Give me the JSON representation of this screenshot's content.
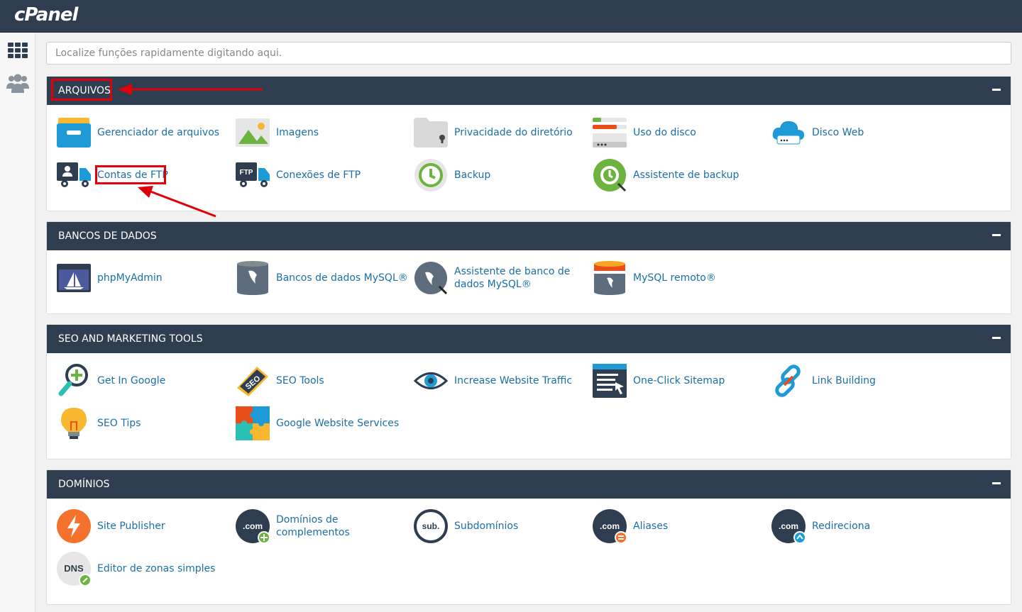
{
  "header": {
    "logo": "cPanel"
  },
  "sidebar": {
    "items": [
      {
        "icon": "grid-icon"
      },
      {
        "icon": "users-icon"
      }
    ]
  },
  "search": {
    "placeholder": "Localize funções rapidamente digitando aqui."
  },
  "sections": [
    {
      "title": "ARQUIVOS",
      "items": [
        {
          "label": "Gerenciador de arquivos",
          "icon": "file-manager-icon"
        },
        {
          "label": "Imagens",
          "icon": "images-icon"
        },
        {
          "label": "Privacidade do diretório",
          "icon": "directory-privacy-icon"
        },
        {
          "label": "Uso do disco",
          "icon": "disk-usage-icon"
        },
        {
          "label": "Disco Web",
          "icon": "web-disk-icon"
        },
        {
          "label": "Contas de FTP",
          "icon": "ftp-accounts-icon"
        },
        {
          "label": "Conexões de FTP",
          "icon": "ftp-connections-icon"
        },
        {
          "label": "Backup",
          "icon": "backup-icon"
        },
        {
          "label": "Assistente de backup",
          "icon": "backup-wizard-icon"
        }
      ]
    },
    {
      "title": "BANCOS DE DADOS",
      "items": [
        {
          "label": "phpMyAdmin",
          "icon": "phpmyadmin-icon"
        },
        {
          "label": "Bancos de dados MySQL®",
          "icon": "mysql-databases-icon"
        },
        {
          "label": "Assistente de banco de dados MySQL®",
          "icon": "mysql-wizard-icon"
        },
        {
          "label": "MySQL remoto®",
          "icon": "remote-mysql-icon"
        }
      ]
    },
    {
      "title": "SEO AND MARKETING TOOLS",
      "items": [
        {
          "label": "Get In Google",
          "icon": "get-in-google-icon"
        },
        {
          "label": "SEO Tools",
          "icon": "seo-tools-icon"
        },
        {
          "label": "Increase Website Traffic",
          "icon": "eye-icon"
        },
        {
          "label": "One-Click Sitemap",
          "icon": "sitemap-icon"
        },
        {
          "label": "Link Building",
          "icon": "link-icon"
        },
        {
          "label": "SEO Tips",
          "icon": "lightbulb-icon"
        },
        {
          "label": "Google Website Services",
          "icon": "puzzle-icon"
        }
      ]
    },
    {
      "title": "DOMÍNIOS",
      "items": [
        {
          "label": "Site Publisher",
          "icon": "site-publisher-icon"
        },
        {
          "label": "Domínios de complementos",
          "icon": "addon-domains-icon"
        },
        {
          "label": "Subdomínios",
          "icon": "subdomains-icon"
        },
        {
          "label": "Aliases",
          "icon": "aliases-icon"
        },
        {
          "label": "Redireciona",
          "icon": "redirects-icon"
        },
        {
          "label": "Editor de zonas simples",
          "icon": "zone-editor-icon"
        }
      ]
    }
  ],
  "annotation_color": "#e0000b"
}
